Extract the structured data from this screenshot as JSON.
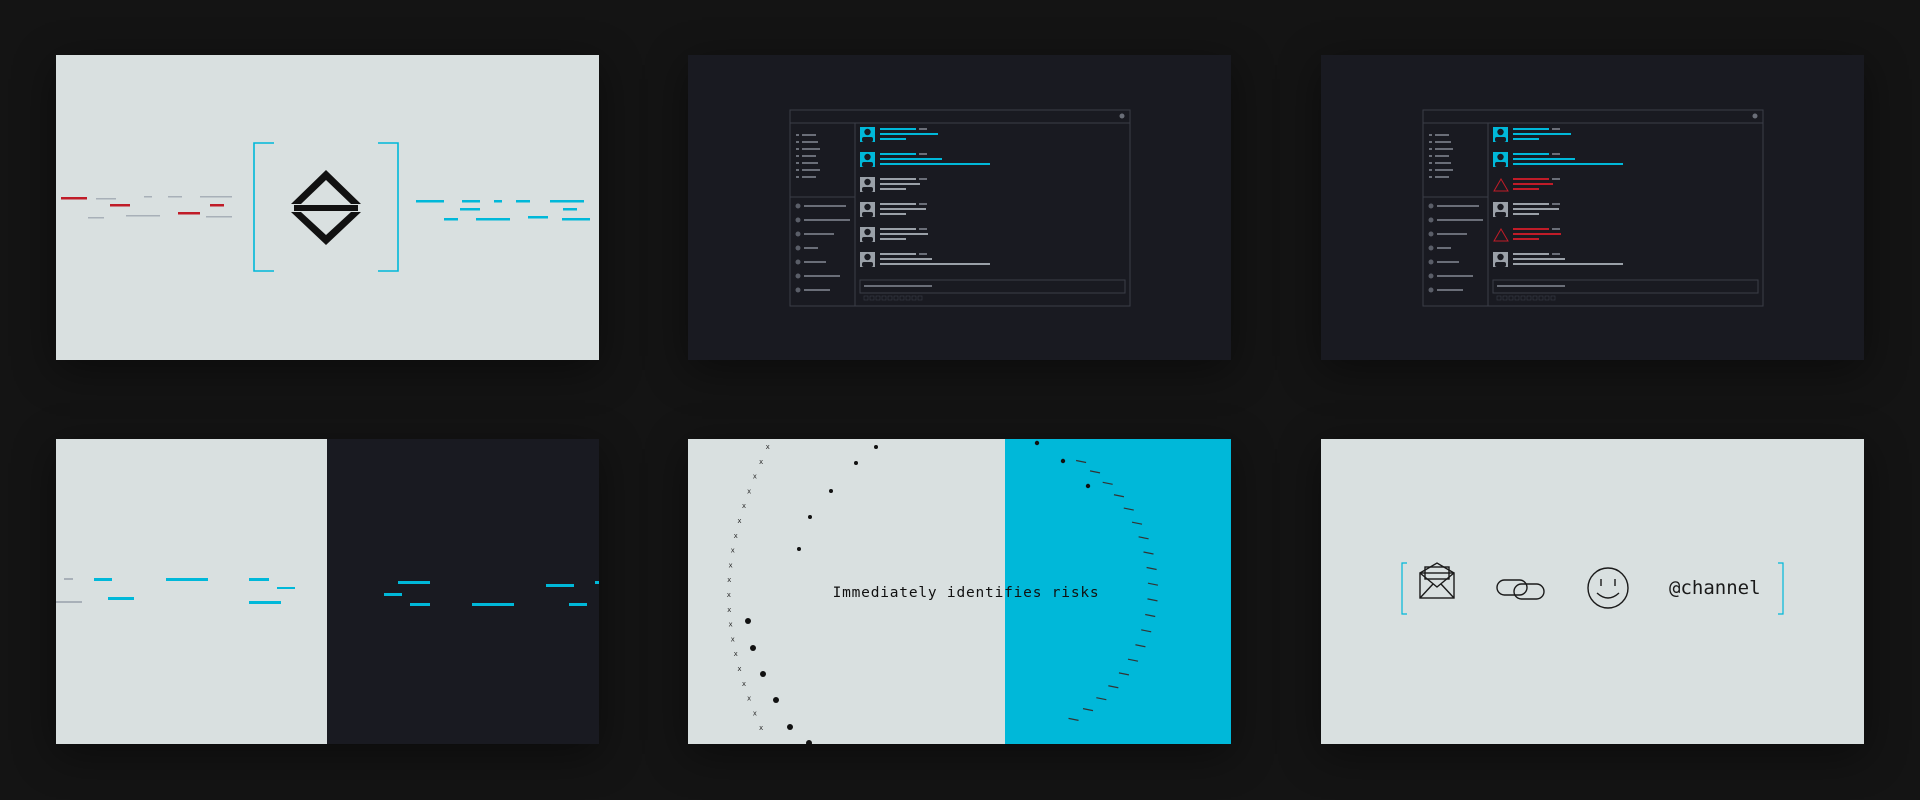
{
  "panels": {
    "risk_caption": "Immediately identifies risks",
    "channel_label": "@channel"
  },
  "colors": {
    "background": "#141414",
    "light_panel": "#d9e0e0",
    "dark_panel": "#191a21",
    "accent_cyan": "#00b8d9",
    "alert_red": "#c01c28"
  },
  "icons": {
    "merge_symbol": "merge-arrows-icon",
    "envelope": "envelope-icon",
    "link": "link-icon",
    "smiley": "smiley-icon"
  }
}
